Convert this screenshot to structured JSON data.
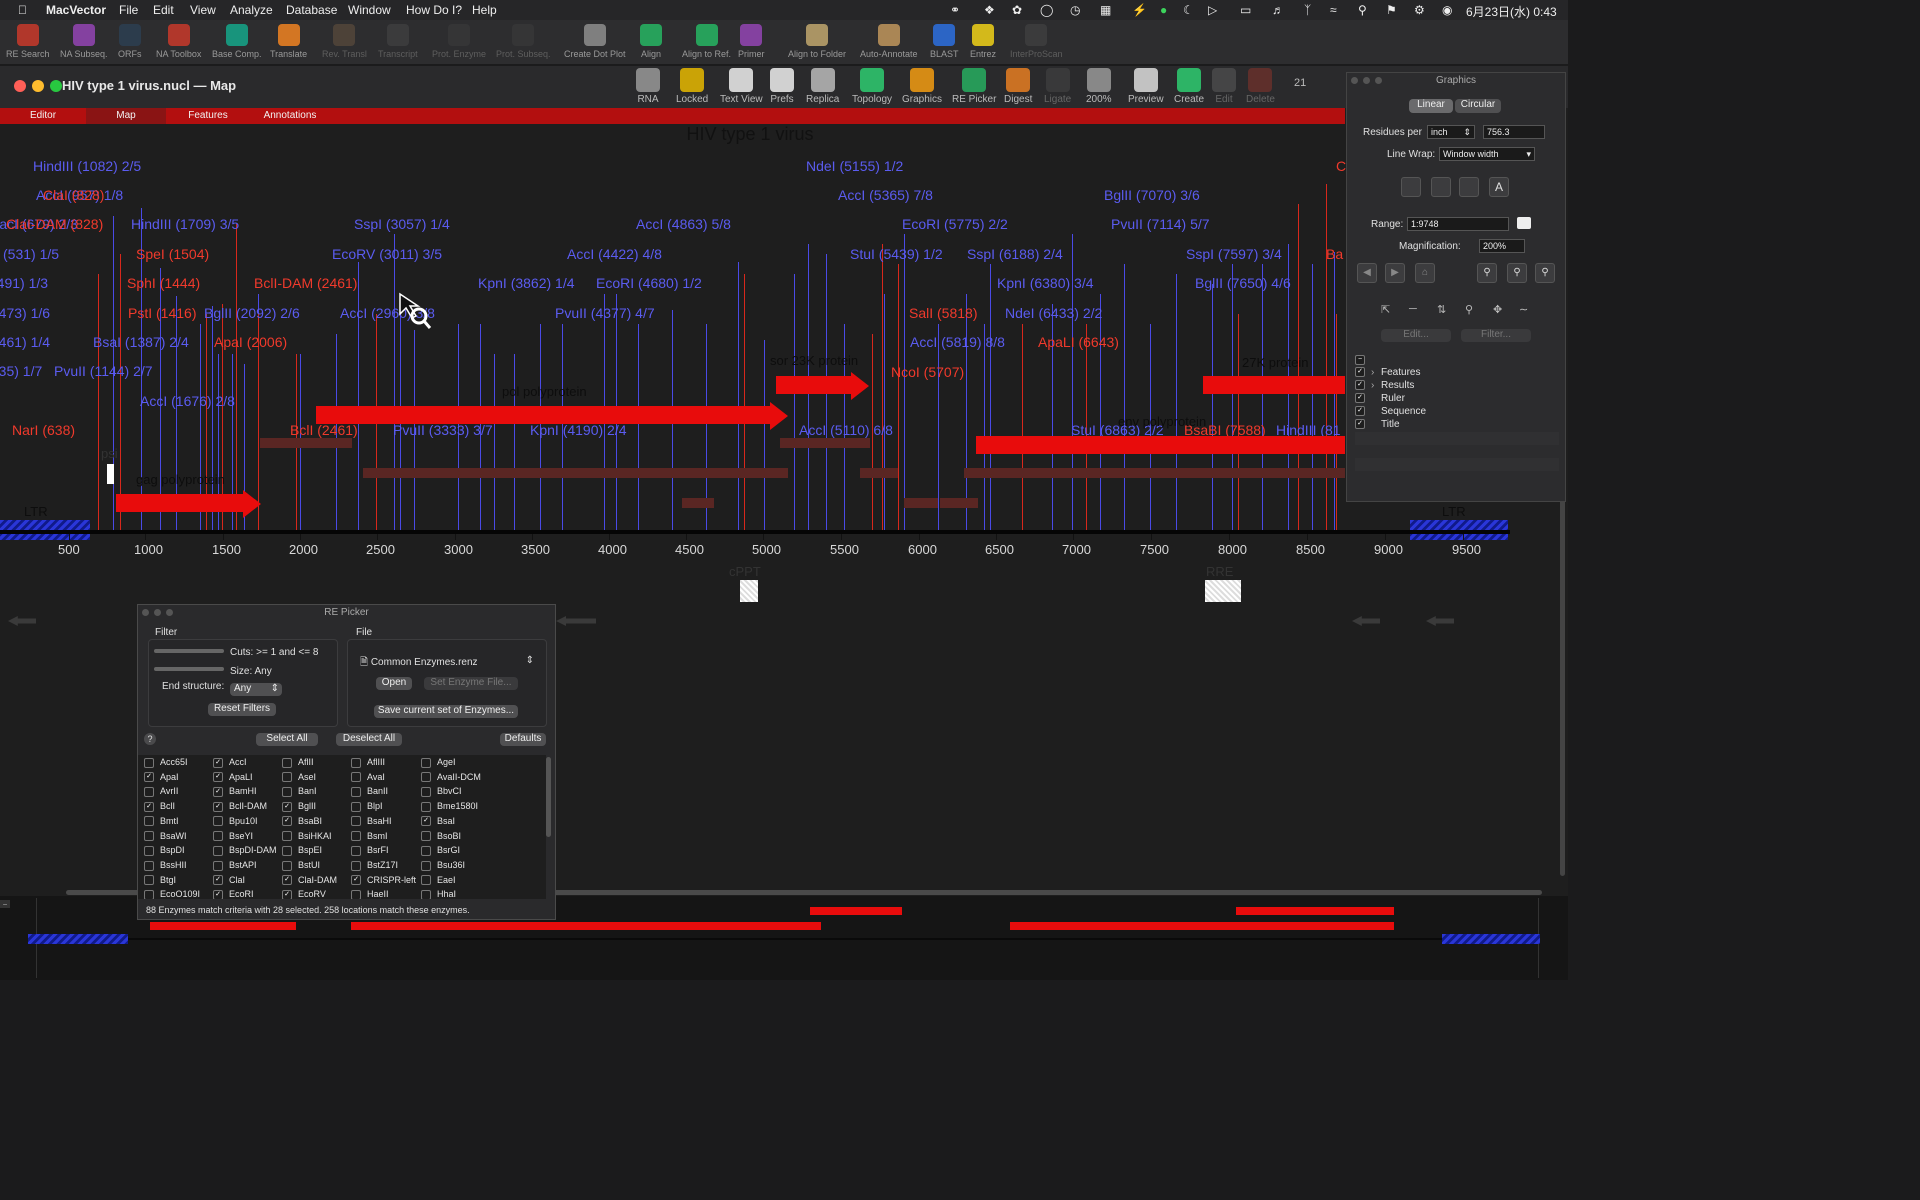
{
  "menubar": {
    "items": [
      "MacVector",
      "File",
      "Edit",
      "View",
      "Analyze",
      "Database",
      "Window",
      "How Do I?",
      "Help"
    ],
    "clock": "6月23日(水)  0:43"
  },
  "app_toolbar": [
    {
      "label": "RE Search",
      "dim": false
    },
    {
      "label": "NA Subseq.",
      "dim": false
    },
    {
      "label": "ORFs",
      "dim": false
    },
    {
      "label": "NA Toolbox",
      "dim": false
    },
    {
      "label": "Base Comp.",
      "dim": false
    },
    {
      "label": "Translate",
      "dim": false
    },
    {
      "label": "Rev. Transl",
      "dim": true
    },
    {
      "label": "Transcript",
      "dim": true
    },
    {
      "label": "Prot. Enzyme",
      "dim": true
    },
    {
      "label": "Prot. Subseq.",
      "dim": true
    },
    {
      "label": "Create Dot Plot",
      "dim": false
    },
    {
      "label": "Align",
      "dim": false
    },
    {
      "label": "Align to Ref.",
      "dim": false
    },
    {
      "label": "Primer",
      "dim": false
    },
    {
      "label": "Align to Folder",
      "dim": false
    },
    {
      "label": "Auto-Annotate",
      "dim": false
    },
    {
      "label": "BLAST",
      "dim": false
    },
    {
      "label": "Entrez",
      "dim": false
    },
    {
      "label": "InterProScan",
      "dim": true
    }
  ],
  "document": {
    "title": "HIV type 1 virus.nucl — Map",
    "toolbar": [
      {
        "label": "RNA",
        "dim": false
      },
      {
        "label": "Locked",
        "dim": false
      },
      {
        "label": "Text View",
        "dim": false
      },
      {
        "label": "Prefs",
        "dim": false
      },
      {
        "label": "Replica",
        "dim": false
      },
      {
        "label": "Topology",
        "dim": false
      },
      {
        "label": "Graphics",
        "dim": false
      },
      {
        "label": "RE Picker",
        "dim": false
      },
      {
        "label": "Digest",
        "dim": false
      },
      {
        "label": "Ligate",
        "dim": true
      },
      {
        "label": "200%",
        "dim": false
      },
      {
        "label": "Preview",
        "dim": false
      },
      {
        "label": "Create",
        "dim": false
      },
      {
        "label": "Edit",
        "dim": true
      },
      {
        "label": "Delete",
        "dim": true
      }
    ],
    "toolbar_extra": "21",
    "tabs": [
      "Editor",
      "Map",
      "Features",
      "Annotations"
    ],
    "active_tab": "Map"
  },
  "map": {
    "title": "HIV type 1 virus",
    "axis_ticks": [
      "500",
      "1000",
      "1500",
      "2000",
      "2500",
      "3000",
      "3500",
      "4000",
      "4500",
      "5000",
      "5500",
      "6000",
      "6500",
      "7000",
      "7500",
      "8000",
      "8500",
      "9000",
      "9500"
    ],
    "sites_blue": [
      "HindIII (1082) 2/5",
      "AccI (957) 1/8",
      "SacI (679) 2/3",
      "(531) 1/5",
      "(491) 1/3",
      "(473) 1/6",
      "(461) 1/4",
      "(35) 1/7",
      "PvuII (1144) 2/7",
      "BsaI (1387) 2/4",
      "HindIII (1709) 3/5",
      "BglII (2092) 2/6",
      "AccI (1676) 2/8",
      "SspI (3057) 1/4",
      "EcoRV (3011) 3/5",
      "AccI (2960) 3/8",
      "PvuII (3333) 3/7",
      "AccI (4863) 5/8",
      "AccI (4422) 4/8",
      "KpnI (3862) 1/4",
      "EcoRI (4680) 1/2",
      "PvuII (4377) 4/7",
      "KpnI (4190) 2/4",
      "NdeI (5155) 1/2",
      "AccI (5365) 7/8",
      "StuI (5439) 1/2",
      "EcoRI (5775) 2/2",
      "SspI (6188) 2/4",
      "AccI (5819) 8/8",
      "KpnI (6380) 3/4",
      "NdeI (6433) 2/2",
      "AccI (5110) 6/8",
      "BglII (7070) 3/6",
      "PvuII (7114) 5/7",
      "SspI (7597) 3/4",
      "BglII (7650) 4/6",
      "StuI (6863) 2/2",
      "HindIII (81"
    ],
    "sites_red": [
      "ClaI (828)",
      "ClaI-DAM (828)",
      "SpeI (1504)",
      "SphI (1444)",
      "PstI (1416)",
      "BclI-DAM (2461)",
      "ApaI (2006)",
      "NarI (638)",
      "BclI (2461)",
      "SalI (5818)",
      "NcoI (5707)",
      "ApaLI (6643)",
      "BsaBI (7588)",
      "C",
      "Ba"
    ],
    "features": {
      "pol": "pol polyprotein",
      "sor": "sor 23K protein",
      "env": "env polyprotein",
      "k27": "27K protein",
      "gag": "gag polyprotein",
      "ltr_left": "LTR",
      "ltr_right": "LTR",
      "psi": "psi",
      "cppt": "cPPT",
      "rre": "RRE"
    }
  },
  "graphics_panel": {
    "title": "Graphics",
    "mode_linear": "Linear",
    "mode_circular": "Circular",
    "residues_per_label": "Residues per",
    "residues_unit": "inch",
    "residues_value": "756.3",
    "line_wrap_label": "Line Wrap:",
    "line_wrap_value": "Window width",
    "range_label": "Range:",
    "range_value": "1:9748",
    "magnification_label": "Magnification:",
    "magnification_value": "200%",
    "edit_btn": "Edit...",
    "filter_btn": "Filter...",
    "tree": [
      {
        "label": "Features",
        "checked": true,
        "expand": true
      },
      {
        "label": "Results",
        "checked": true,
        "expand": true
      },
      {
        "label": "Ruler",
        "checked": true,
        "expand": false
      },
      {
        "label": "Sequence",
        "checked": true,
        "expand": false
      },
      {
        "label": "Title",
        "checked": true,
        "expand": false
      }
    ]
  },
  "re_picker": {
    "title": "RE Picker",
    "filter_heading": "Filter",
    "file_heading": "File",
    "cuts_label": "Cuts: >= 1 and <= 8",
    "size_label": "Size: Any",
    "end_structure_label": "End structure:",
    "end_structure_value": "Any",
    "reset_filters": "Reset Filters",
    "file_value": "Common Enzymes.renz",
    "open_btn": "Open",
    "set_enzyme_btn": "Set Enzyme File...",
    "save_btn": "Save current set of Enzymes...",
    "help": "?",
    "select_all": "Select All",
    "deselect_all": "Deselect All",
    "defaults": "Defaults",
    "enzymes": [
      [
        {
          "n": "Acc65I",
          "c": false
        },
        {
          "n": "AccI",
          "c": true
        },
        {
          "n": "AflII",
          "c": false
        },
        {
          "n": "AflIII",
          "c": false
        },
        {
          "n": "AgeI",
          "c": false
        }
      ],
      [
        {
          "n": "ApaI",
          "c": true
        },
        {
          "n": "ApaLI",
          "c": true
        },
        {
          "n": "AseI",
          "c": false
        },
        {
          "n": "AvaI",
          "c": false
        },
        {
          "n": "AvaII-DCM",
          "c": false
        }
      ],
      [
        {
          "n": "AvrII",
          "c": false
        },
        {
          "n": "BamHI",
          "c": true
        },
        {
          "n": "BanI",
          "c": false
        },
        {
          "n": "BanII",
          "c": false
        },
        {
          "n": "BbvCI",
          "c": false
        }
      ],
      [
        {
          "n": "BclI",
          "c": true
        },
        {
          "n": "BclI-DAM",
          "c": true
        },
        {
          "n": "BglII",
          "c": true
        },
        {
          "n": "BlpI",
          "c": false
        },
        {
          "n": "Bme1580I",
          "c": false
        }
      ],
      [
        {
          "n": "BmtI",
          "c": false
        },
        {
          "n": "Bpu10I",
          "c": false
        },
        {
          "n": "BsaBI",
          "c": true
        },
        {
          "n": "BsaHI",
          "c": false
        },
        {
          "n": "BsaI",
          "c": true
        }
      ],
      [
        {
          "n": "BsaWI",
          "c": false
        },
        {
          "n": "BseYI",
          "c": false
        },
        {
          "n": "BsiHKAI",
          "c": false
        },
        {
          "n": "BsmI",
          "c": false
        },
        {
          "n": "BsoBI",
          "c": false
        }
      ],
      [
        {
          "n": "BspDI",
          "c": false
        },
        {
          "n": "BspDI-DAM",
          "c": false
        },
        {
          "n": "BspEI",
          "c": false
        },
        {
          "n": "BsrFI",
          "c": false
        },
        {
          "n": "BsrGI",
          "c": false
        }
      ],
      [
        {
          "n": "BssHII",
          "c": false
        },
        {
          "n": "BstAPI",
          "c": false
        },
        {
          "n": "BstUI",
          "c": false
        },
        {
          "n": "BstZ17I",
          "c": false
        },
        {
          "n": "Bsu36I",
          "c": false
        }
      ],
      [
        {
          "n": "BtgI",
          "c": false
        },
        {
          "n": "ClaI",
          "c": true
        },
        {
          "n": "ClaI-DAM",
          "c": true
        },
        {
          "n": "CRISPR-left",
          "c": true
        },
        {
          "n": "EaeI",
          "c": false
        }
      ],
      [
        {
          "n": "EcoO109I",
          "c": false
        },
        {
          "n": "EcoRI",
          "c": true
        },
        {
          "n": "EcoRV",
          "c": true
        },
        {
          "n": "HaeII",
          "c": false
        },
        {
          "n": "HhaI",
          "c": false
        }
      ]
    ],
    "status": "88 Enzymes match criteria with 28 selected. 258 locations match these enzymes."
  },
  "colors": {
    "site_blue": "#5b5cf0",
    "site_red": "#f03a2c",
    "feature_red": "#e80c0c",
    "ltr_blue": "#2a36d8",
    "tab_bar": "#b30f0f"
  }
}
